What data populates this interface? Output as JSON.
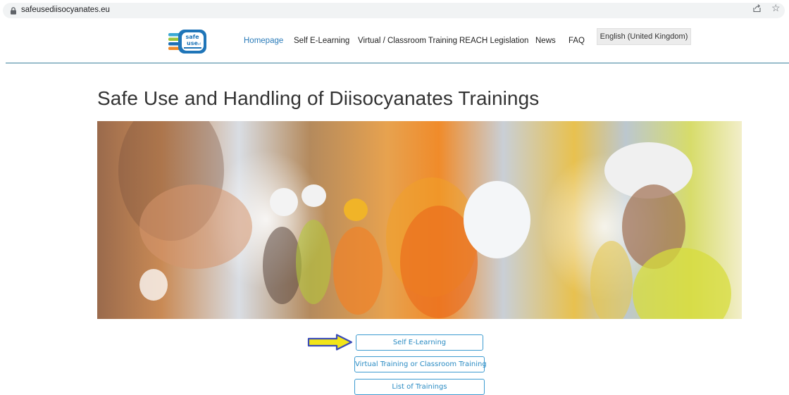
{
  "browser": {
    "url": "safeusediisocyanates.eu"
  },
  "header": {
    "logo_alt": "safe use of diisocyanates",
    "nav": [
      {
        "label": "Homepage",
        "active": true
      },
      {
        "label": "Self E-Learning",
        "active": false
      },
      {
        "label": "Virtual / Classroom Training",
        "active": false
      },
      {
        "label": "REACH Legislation",
        "active": false
      },
      {
        "label": "News",
        "active": false
      },
      {
        "label": "FAQ",
        "active": false
      }
    ],
    "language": "English (United Kingdom)"
  },
  "main": {
    "title": "Safe Use and Handling of Diisocyanates Trainings",
    "buttons": [
      {
        "label": "Self E-Learning"
      },
      {
        "label": "Virtual Training or Classroom Training"
      },
      {
        "label": "List of Trainings"
      }
    ]
  },
  "colors": {
    "accent": "#2a7bb9",
    "button_border": "#3d9bd0",
    "rule": "#3a7f9b",
    "arrow_fill": "#f2e51a",
    "arrow_stroke": "#3a4bb8"
  },
  "icons": {
    "lock": "lock-icon",
    "share": "share-icon",
    "star": "star-icon",
    "arrow": "arrow-right-icon"
  }
}
